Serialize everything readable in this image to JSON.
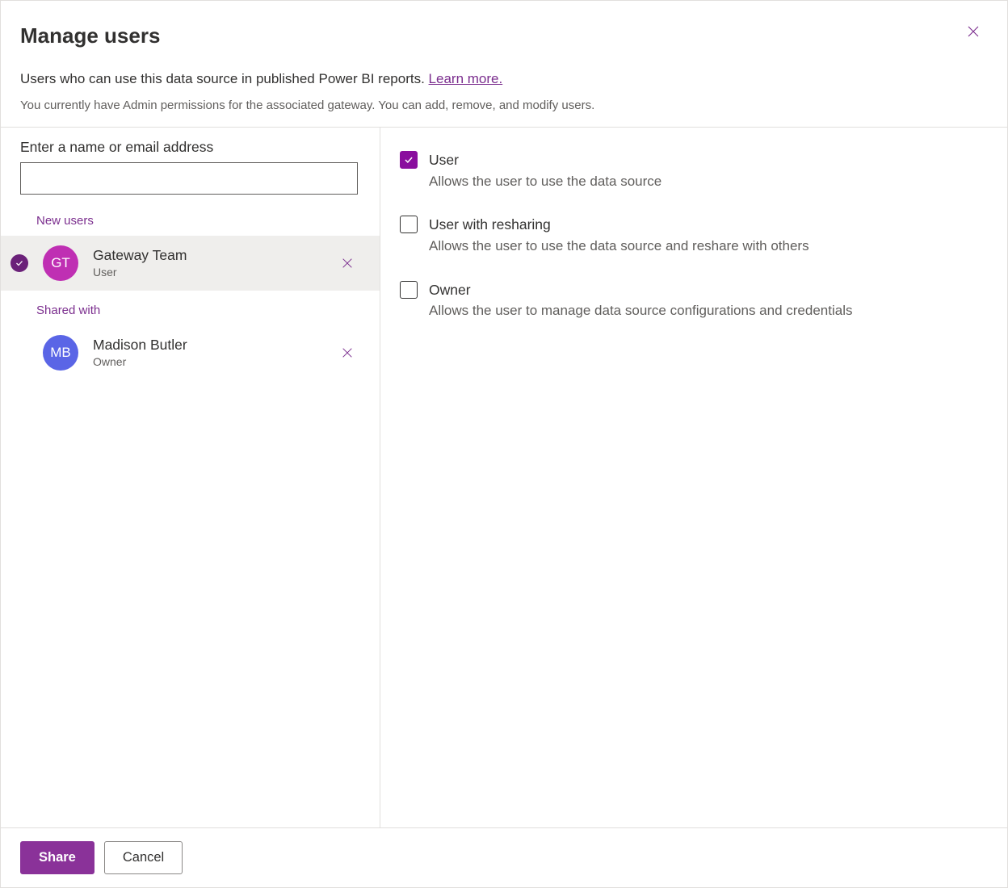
{
  "header": {
    "title": "Manage users",
    "description": "Users who can use this data source in published Power BI reports. ",
    "learn_more": "Learn more.",
    "perm_note": "You currently have Admin permissions for the associated gateway. You can add, remove, and modify users."
  },
  "left": {
    "input_label": "Enter a name or email address",
    "input_value": "",
    "new_users_label": "New users",
    "shared_with_label": "Shared with",
    "new_users": [
      {
        "initials": "GT",
        "name": "Gateway Team",
        "role": "User",
        "avatar_color": "magenta",
        "selected": true
      }
    ],
    "shared_with": [
      {
        "initials": "MB",
        "name": "Madison Butler",
        "role": "Owner",
        "avatar_color": "blue",
        "selected": false
      }
    ]
  },
  "roles": [
    {
      "title": "User",
      "desc": "Allows the user to use the data source",
      "checked": true
    },
    {
      "title": "User with resharing",
      "desc": "Allows the user to use the data source and reshare with others",
      "checked": false
    },
    {
      "title": "Owner",
      "desc": "Allows the user to manage data source configurations and credentials",
      "checked": false
    }
  ],
  "footer": {
    "share": "Share",
    "cancel": "Cancel"
  }
}
